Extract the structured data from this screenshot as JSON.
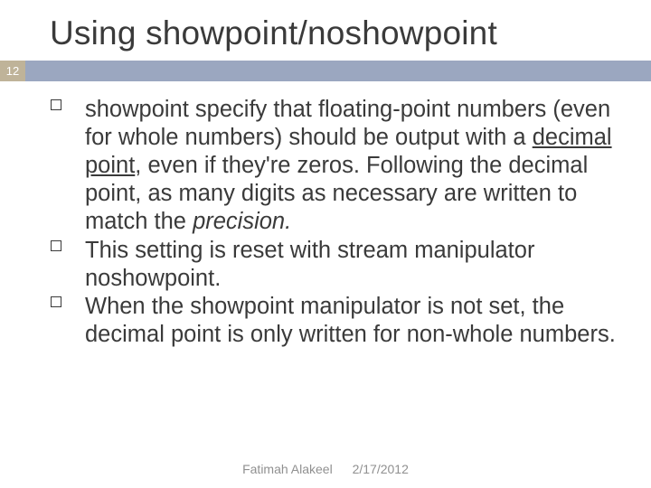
{
  "title": "Using showpoint/noshowpoint",
  "page_number": "12",
  "bullets": {
    "b1_pre": "showpoint specify that floating-point numbers (even for whole numbers) should be output with a ",
    "b1_ul": "decimal point",
    "b1_mid": ", even if they're zeros. Following the decimal point, as many digits as necessary are written to match the ",
    "b1_it": "precision.",
    "b2": "This setting is reset with stream manipulator noshowpoint.",
    "b3": "When the showpoint  manipulator is not set, the decimal point is only written for non-whole numbers."
  },
  "footer": {
    "author": "Fatimah Alakeel",
    "date": "2/17/2012"
  }
}
